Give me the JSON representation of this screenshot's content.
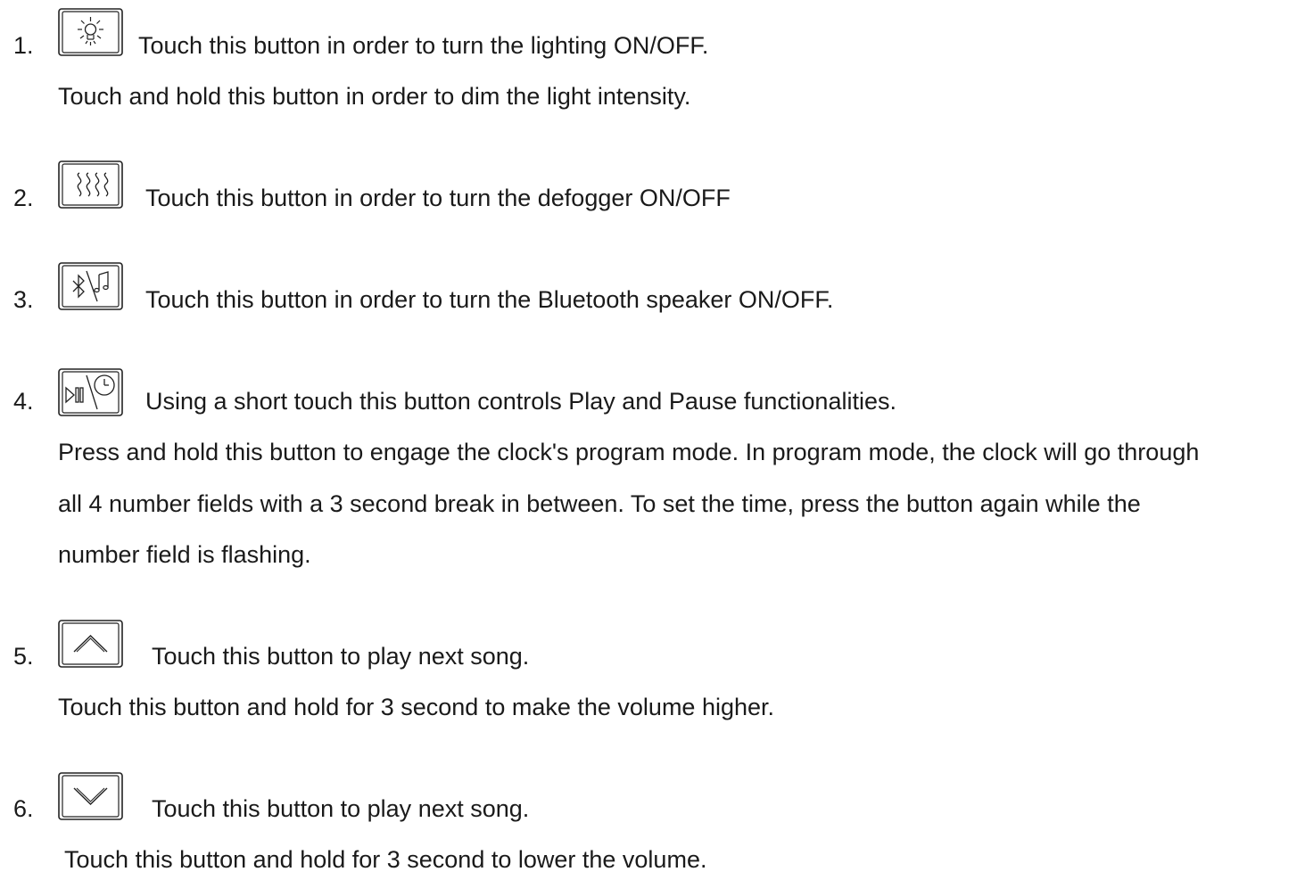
{
  "items": [
    {
      "number": "1.",
      "icon": "light-bulb-icon",
      "text": "Touch this button in order to turn the lighting ON/OFF.",
      "extra": [
        "Touch and hold this button in order to dim the light intensity."
      ]
    },
    {
      "number": "2.",
      "icon": "defogger-icon",
      "text": "Touch this button in order to turn the defogger ON/OFF",
      "extra": []
    },
    {
      "number": "3.",
      "icon": "bluetooth-music-icon",
      "text": "Touch this button in order to turn the Bluetooth speaker ON/OFF.",
      "extra": []
    },
    {
      "number": "4.",
      "icon": "play-pause-clock-icon",
      "text": "Using a short touch this button controls Play and Pause functionalities.",
      "extra": [
        "Press and hold this button to engage the clock's program mode. In program mode, the clock will  go through",
        "all 4 number fields with a 3 second break in between. To set the time, press the button again while the",
        "number field is flashing."
      ]
    },
    {
      "number": "5.",
      "icon": "chevron-up-icon",
      "text": "Touch this button to play next song.",
      "extra": [
        "Touch this button and hold for 3 second to make the volume higher."
      ]
    },
    {
      "number": "6.",
      "icon": "chevron-down-icon",
      "text": "Touch this button to play next song.",
      "extra": [
        " Touch this button and hold for 3 second to lower the volume."
      ]
    }
  ]
}
